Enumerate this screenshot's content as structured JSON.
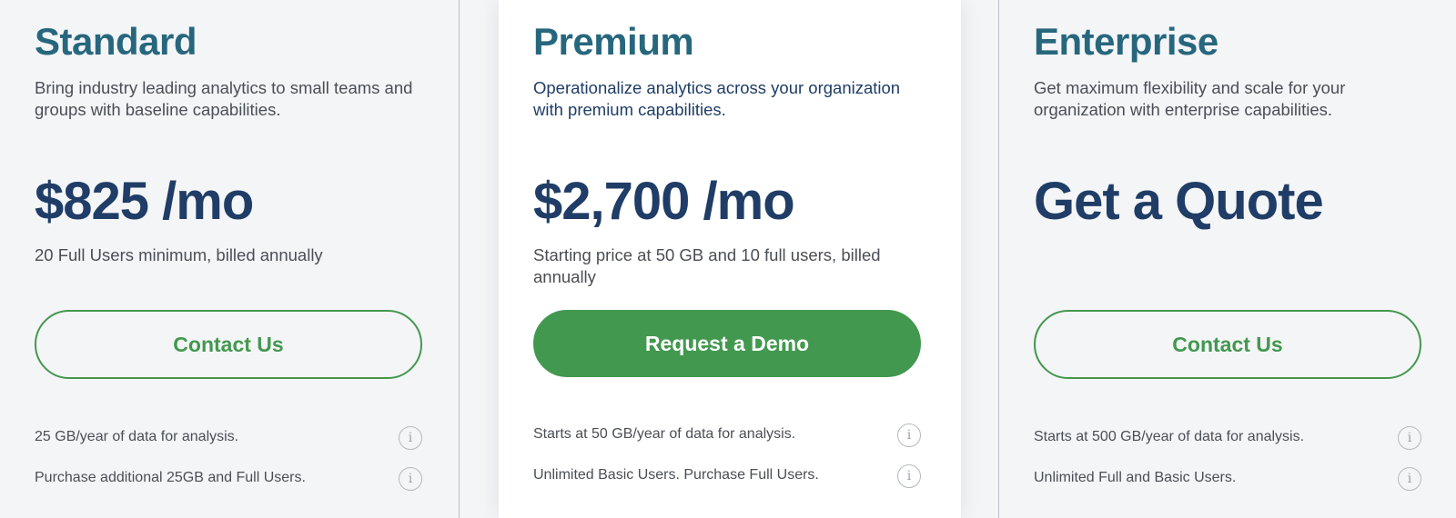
{
  "plans": [
    {
      "name": "Standard",
      "description": "Bring industry leading analytics to small teams and groups with baseline capabilities.",
      "price": "$825 /mo",
      "billing": "20 Full Users minimum, billed annually",
      "cta": "Contact Us",
      "features": [
        {
          "text": "25 GB/year of data for analysis.",
          "icon": "info-icon"
        },
        {
          "text": "Purchase additional 25GB and Full Users.",
          "icon": "info-icon"
        }
      ]
    },
    {
      "name": "Premium",
      "description": "Operationalize analytics across your organization with premium capabilities.",
      "price": "$2,700 /mo",
      "billing": "Starting price at 50 GB and 10 full users, billed annually",
      "cta": "Request a Demo",
      "features": [
        {
          "text": "Starts at 50 GB/year of data for analysis.",
          "icon": "info-icon"
        },
        {
          "text": "Unlimited Basic Users. Purchase Full Users.",
          "icon": "info-icon"
        }
      ]
    },
    {
      "name": "Enterprise",
      "description": "Get maximum flexibility and scale for your organization with enterprise capabilities.",
      "price": "Get a Quote",
      "billing": "",
      "cta": "Contact Us",
      "features": [
        {
          "text": "Starts at 500 GB/year of data for analysis.",
          "icon": "info-icon"
        },
        {
          "text": "Unlimited Full and Basic Users.",
          "icon": "info-icon"
        }
      ]
    }
  ],
  "info_glyph": "i",
  "colors": {
    "heading_teal": "#27677e",
    "price_navy": "#1f3d66",
    "accent_green": "#43984f",
    "page_background": "#f4f5f7",
    "featured_background": "#ffffff"
  }
}
